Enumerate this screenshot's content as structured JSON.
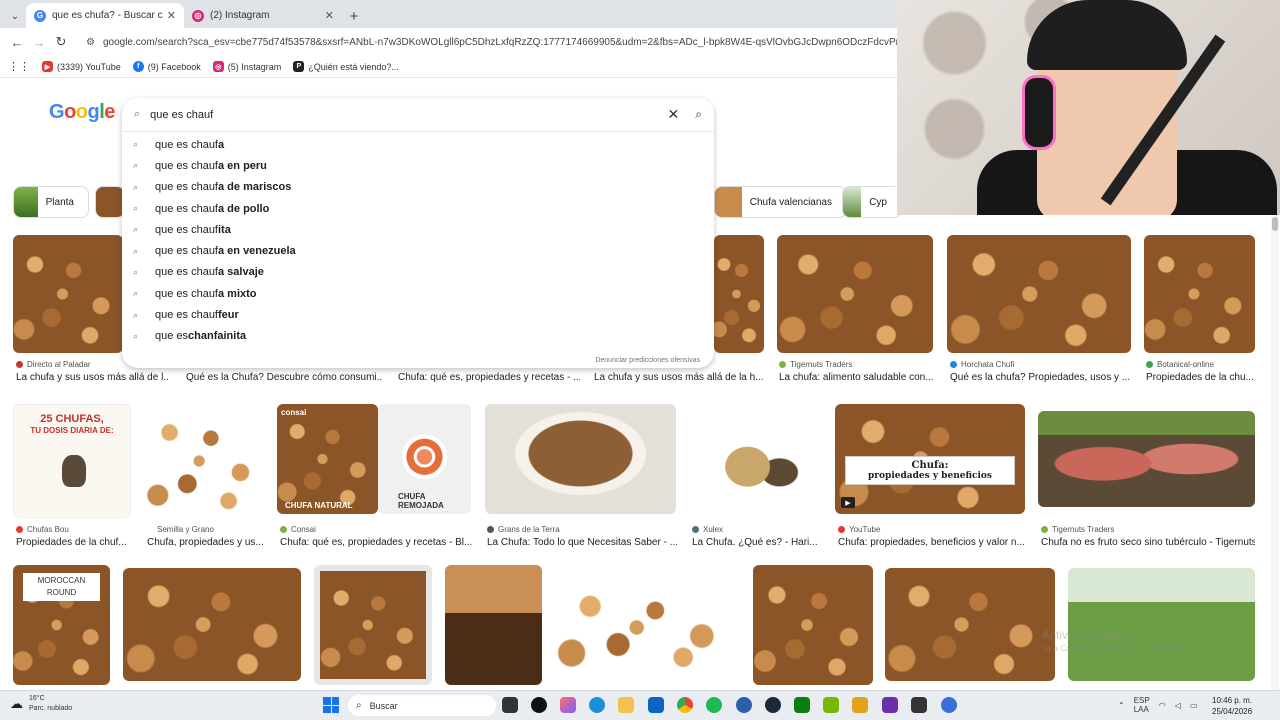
{
  "browser": {
    "tabs": [
      {
        "label": "que es chufa? - Buscar con Goo",
        "icon": "google-icon",
        "active": true
      },
      {
        "label": "(2) Instagram",
        "icon": "instagram-icon",
        "active": false
      }
    ],
    "url": "google.com/search?sca_esv=cbe775d74f53578&sxsrf=ANbL-n7w3DKoWOLgll6pC5DhzLxfqRzZQ:1777174669905&udm=2&fbs=ADc_l-bpk8W4E-qsVlOvbGJcDwpn6ODczFdcvPnuv8WQoh9Tir",
    "bookmarks": [
      {
        "label": "(3339) YouTube",
        "icon": "youtube-icon",
        "color": "#e53935"
      },
      {
        "label": "(9) Facebook",
        "icon": "facebook-icon",
        "color": "#1877f2"
      },
      {
        "label": "(5) Instagram",
        "icon": "instagram-icon",
        "color": "#d62976"
      },
      {
        "label": "¿Quién está viendo?...",
        "icon": "prime-icon",
        "color": "#222222"
      }
    ]
  },
  "google": {
    "logo_letters": [
      "G",
      "o",
      "o",
      "g",
      "l",
      "e"
    ],
    "logo_colors": [
      "#4285f4",
      "#ea4335",
      "#fbbc05",
      "#4285f4",
      "#34a853",
      "#ea4335"
    ]
  },
  "search": {
    "query": "que es chauf",
    "suggestions": [
      {
        "prefix": "que es chauf",
        "suffix": "a"
      },
      {
        "prefix": "que es chauf",
        "suffix": "a en peru"
      },
      {
        "prefix": "que es chauf",
        "suffix": "a de mariscos"
      },
      {
        "prefix": "que es chauf",
        "suffix": "a de pollo"
      },
      {
        "prefix": "que es chauf",
        "suffix": "ita"
      },
      {
        "prefix": "que es chauf",
        "suffix": "a en venezuela"
      },
      {
        "prefix": "que es chauf",
        "suffix": "a salvaje"
      },
      {
        "prefix": "que es chauf",
        "suffix": "a mixto"
      },
      {
        "prefix": "que es chauf",
        "suffix": "feur"
      },
      {
        "prefix": "que es ",
        "suffix": "chanfainita"
      }
    ],
    "report_label": "Denunciar predicciones ofensivas"
  },
  "chips": {
    "left": [
      "Planta",
      ""
    ],
    "right": [
      "Chufa valencianas",
      "Cyp"
    ]
  },
  "results": {
    "row1": [
      {
        "source": "Directo al Paladar",
        "caption": "La chufa y sus usos más allá de l...",
        "dot": "#c0392b"
      },
      {
        "source": "",
        "caption": "Qué es la Chufa? Descubre cómo consumi...",
        "dot": ""
      },
      {
        "source": "",
        "caption": "Chufa: qué es, propiedades y recetas - ...",
        "dot": ""
      },
      {
        "source": "",
        "caption": "La chufa y sus usos más allá de la h...",
        "dot": ""
      },
      {
        "source": "Tigernuts Traders",
        "caption": "La chufa: alimento saludable con...",
        "dot": "#7cb342"
      },
      {
        "source": "Horchata Chufi",
        "caption": "Qué es la chufa? Propiedades, usos y ...",
        "dot": "#1e88e5"
      },
      {
        "source": "Botanical-online",
        "caption": "Propiedades de la chu...",
        "dot": "#43a047"
      }
    ],
    "row2": [
      {
        "source": "Chufas Bou",
        "caption": "Propiedades de la chuf...",
        "dot": "#e53935"
      },
      {
        "source": "Semilla y Grano",
        "caption": "Chufa, propiedades y us...",
        "dot": ""
      },
      {
        "source": "Consai",
        "caption": "Chufa: qué es, propiedades y recetas - Bl...",
        "dot": "#7cb342"
      },
      {
        "source": "Grans de la Terra",
        "caption": "La Chufa: Todo lo que Necesitas Saber - ...",
        "dot": "#555555"
      },
      {
        "source": "Xulex",
        "caption": "La Chufa. ¿Qué es? - Hari...",
        "dot": "#546e7a"
      },
      {
        "source": "YouTube",
        "caption": "Chufa: propiedades, beneficios y valor n...",
        "dot": "#e53935"
      },
      {
        "source": "Tigernuts Traders",
        "caption": "Chufa no es fruto seco sino tubérculo - Tigernuts",
        "dot": "#7cb342"
      }
    ],
    "row2_overlays": {
      "chufas_title": "25 CHUFAS,",
      "chufas_sub": "TU DOSIS DIARIA DE:",
      "consai_left": "CHUFA NATURAL",
      "consai_right": "CHUFA REMOJADA",
      "consai_brand": "consai",
      "video_title_1": "Chufa:",
      "video_title_2": "propiedades y beneficios",
      "play": "▶"
    },
    "row3_overlays": {
      "moroccan": "MOROCCAN",
      "round": "ROUND"
    }
  },
  "watermark": {
    "line1": "Activar Windows",
    "line2": "Ve a Configuración para activar Windows."
  },
  "taskbar": {
    "temperature": "16°C",
    "condition": "Parc. nublado",
    "search_label": "Buscar",
    "language_1": "ESP",
    "language_2": "LAA",
    "time": "10:46 p. m.",
    "date": "25/04/2026"
  }
}
